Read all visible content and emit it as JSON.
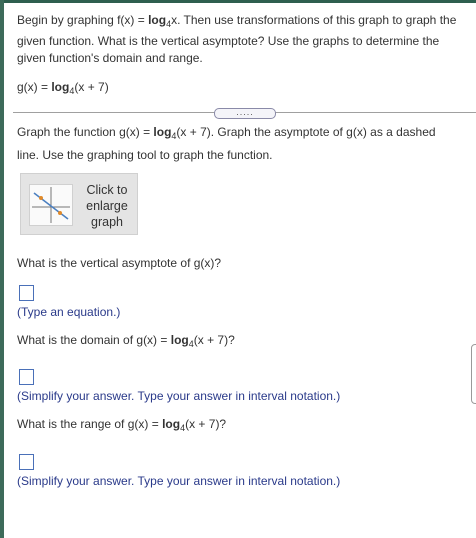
{
  "intro": "Begin by graphing f(x) = log 4x. Then use transformations of this graph to graph the given function. What is the vertical asymptote? Use the graphs to determine the given function's domain and range.",
  "intro_parts": {
    "a": "Begin by graphing f(x) = ",
    "log": "log",
    "base": "4",
    "b": "x. Then use transformations of this graph to graph the given function. What is the vertical asymptote? Use the graphs to determine the given function's domain and range."
  },
  "func": {
    "prefix": "g(x) = ",
    "log": "log",
    "base": "4",
    "arg": "(x + 7)"
  },
  "more_button": ".....",
  "instruction": {
    "a": "Graph the function g(x) = ",
    "log": "log",
    "base": "4",
    "b": "(x + 7).  Graph the asymptote of g(x) as a dashed line. Use the graphing tool to graph the function."
  },
  "enlarge": {
    "line1": "Click to",
    "line2": "enlarge",
    "line3": "graph"
  },
  "q1": "What is the vertical asymptote of g(x)?",
  "hint1": "(Type an equation.)",
  "q2": {
    "a": "What is the domain of g(x) = ",
    "log": "log",
    "base": "4",
    "b": "(x + 7)?"
  },
  "hint2": "(Simplify your answer. Type your answer in interval notation.)",
  "q3": {
    "a": "What is the range of g(x) = ",
    "log": "log",
    "base": "4",
    "b": "(x + 7)?"
  },
  "hint3": "(Simplify your answer. Type your answer in interval notation.)",
  "colors": {
    "accent": "#2f5f4f",
    "hint": "#2a3a8a",
    "input_border": "#4a70b8"
  }
}
